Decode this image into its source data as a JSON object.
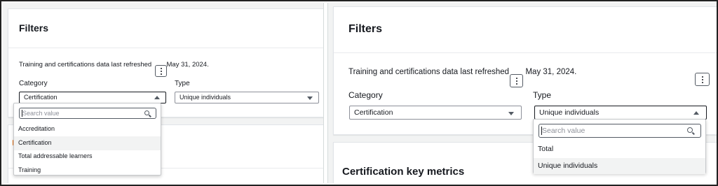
{
  "left": {
    "filters_title": "Filters",
    "refresh_text": "Training and certifications data last refreshed",
    "refresh_date": "May 31, 2024.",
    "category_label": "Category",
    "category_value": "Certification",
    "type_label": "Type",
    "type_value": "Unique individuals",
    "search_placeholder": "Search value",
    "options": [
      "Accreditation",
      "Certification",
      "Total addressable learners",
      "Training"
    ],
    "selected_option": "Certification"
  },
  "right": {
    "filters_title": "Filters",
    "refresh_text": "Training and certifications data last refreshed",
    "refresh_date": "May 31, 2024.",
    "category_label": "Category",
    "category_value": "Certification",
    "type_label": "Type",
    "type_value": "Unique individuals",
    "search_placeholder": "Search value",
    "options": [
      "Total",
      "Unique individuals"
    ],
    "selected_option": "Unique individuals",
    "metrics_title": "Certification key metrics"
  }
}
